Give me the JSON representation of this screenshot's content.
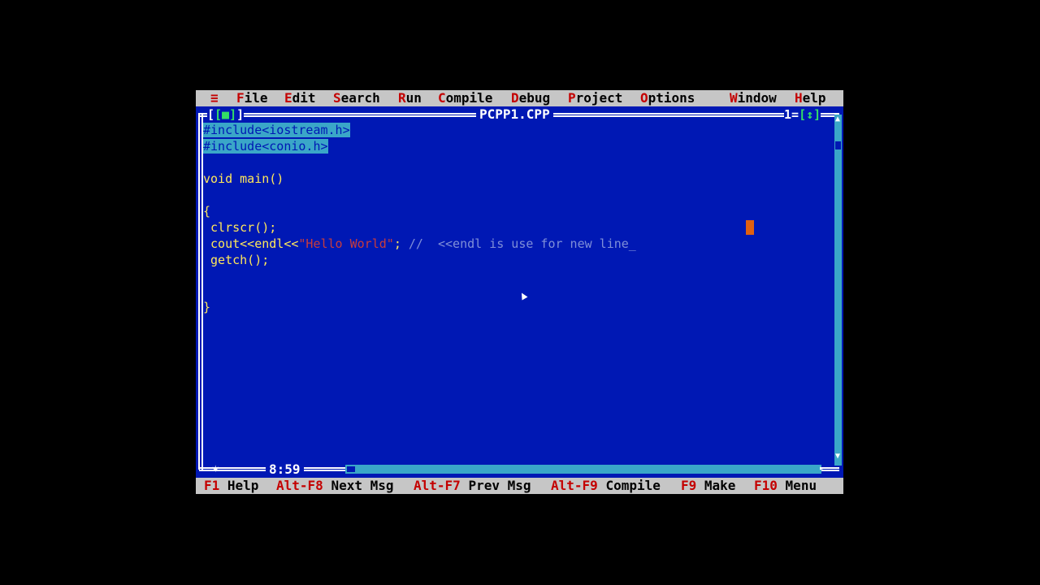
{
  "menu": {
    "system": "≡",
    "items": [
      {
        "hot": "F",
        "rest": "ile"
      },
      {
        "hot": "E",
        "rest": "dit"
      },
      {
        "hot": "S",
        "rest": "earch"
      },
      {
        "hot": "R",
        "rest": "un"
      },
      {
        "hot": "C",
        "rest": "ompile"
      },
      {
        "hot": "D",
        "rest": "ebug"
      },
      {
        "hot": "P",
        "rest": "roject"
      },
      {
        "hot": "O",
        "rest": "ptions"
      },
      {
        "hot": "W",
        "rest": "indow"
      },
      {
        "hot": "H",
        "rest": "elp"
      }
    ]
  },
  "window": {
    "title": "PCPP1.CPP",
    "close_box": "[■]",
    "number": "1",
    "zoom_box": "[↕]",
    "cursor_position": "8:59"
  },
  "editor": {
    "lines": [
      {
        "text": "#include<iostream.h>"
      },
      {
        "text": "#include<conio.h>"
      },
      {
        "text": ""
      },
      {
        "text": "void main()"
      },
      {
        "text": ""
      },
      {
        "text": "{"
      },
      {
        "text": " clrscr();"
      },
      {
        "code": " cout<<endl<<",
        "string": "\"Hello World\"",
        "after": "; ",
        "comment": "//  <<endl is use for new line_"
      },
      {
        "text": " getch();"
      },
      {
        "text": ""
      },
      {
        "text": ""
      },
      {
        "text": "}"
      }
    ]
  },
  "statusbar": {
    "items": [
      {
        "key": "F1",
        "label": "Help"
      },
      {
        "key": "Alt-F8",
        "label": "Next Msg"
      },
      {
        "key": "Alt-F7",
        "label": "Prev Msg"
      },
      {
        "key": "Alt-F9",
        "label": "Compile"
      },
      {
        "key": "F9",
        "label": "Make"
      },
      {
        "key": "F10",
        "label": "Menu"
      }
    ]
  },
  "colors": {
    "background": "#0018b4",
    "menu_bar": "#c6c6c6",
    "hotkey": "#c40000",
    "code_text": "#ffe85a",
    "selection": "#3aa6c8",
    "string": "#c83c3c"
  }
}
